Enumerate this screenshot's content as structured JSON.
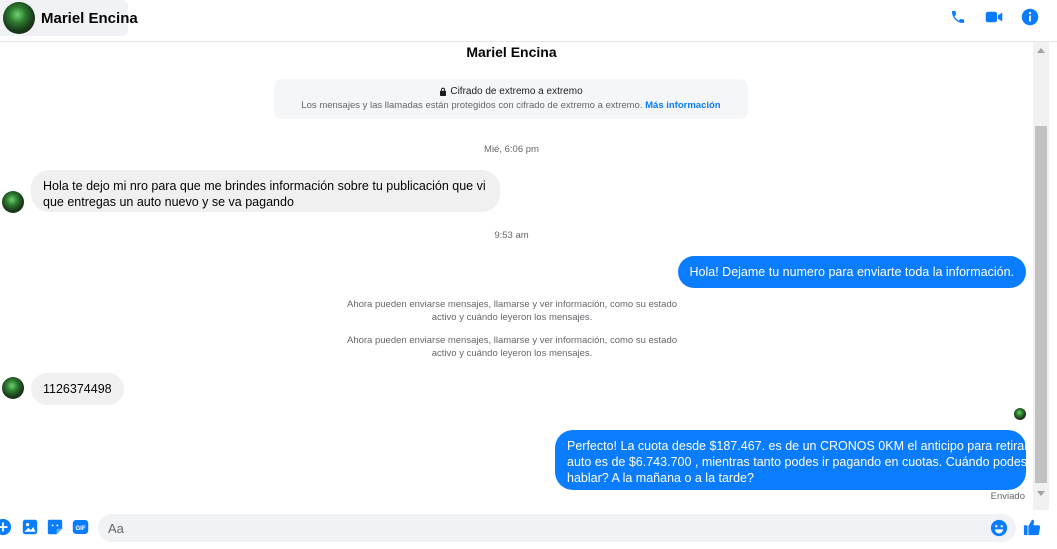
{
  "header": {
    "contact_name": "Mariel Encina",
    "icons": [
      "phone-icon",
      "video-camera-icon",
      "info-icon"
    ],
    "accent_color": "#0a7cff"
  },
  "thread": {
    "title": "Mariel Encina",
    "e2e": {
      "title": "Cifrado de extremo a extremo",
      "description": "Los mensajes y las llamadas están protegidos con cifrado de extremo a extremo.",
      "link": "Más información"
    },
    "timestamps": [
      "Mié, 6:06 pm",
      "9:53 am"
    ],
    "messages": [
      {
        "from": "contact",
        "text_line1": "Hola te dejo mi nro para que me brindes información sobre tu publicación que vi",
        "text_line2": "que entregas un auto nuevo y se va pagando"
      },
      {
        "from": "me",
        "text": "Hola! Dejame tu numero  para enviarte toda la información."
      },
      {
        "from": "contact",
        "text": "1126374498"
      },
      {
        "from": "me",
        "text_line1": "Perfecto! La cuota desde $187.467. es de un CRONOS 0KM el anticipo para retirar el",
        "text_line2": "auto es de $6.743.700 , mientras tanto podes ir pagando en cuotas. Cuándo podes",
        "text_line3": "hablar? A la mañana o a la tarde?"
      }
    ],
    "system_notes": [
      {
        "line1": "Ahora pueden enviarse mensajes, llamarse y ver información, como su estado",
        "line2": "activo y cuándo leyeron los mensajes."
      },
      {
        "line1": "Ahora pueden enviarse mensajes, llamarse y ver información, como su estado",
        "line2": "activo y cuándo leyeron los mensajes."
      }
    ],
    "sent_status": "Enviado"
  },
  "composer": {
    "placeholder": "Aa",
    "icons": [
      "plus-icon",
      "image-icon",
      "sticker-icon",
      "gif-icon",
      "emoji-icon",
      "thumbs-up-icon"
    ]
  }
}
